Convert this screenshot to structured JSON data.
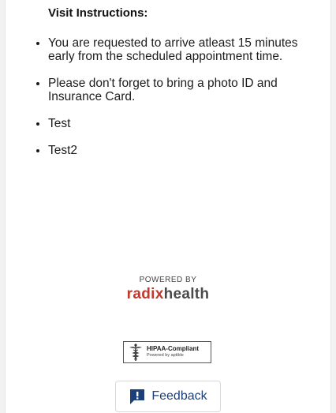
{
  "visit": {
    "title": "Visit Instructions:",
    "items": [
      "You are requested to arrive atleast 15 minutes early from the scheduled appointment time.",
      "Please don't forget to bring a photo ID and Insurance Card.",
      "Test",
      "Test2"
    ]
  },
  "footer": {
    "powered_by": "POWERED BY",
    "brand_part1": "radix",
    "brand_part2": "health",
    "hipaa_title": "HIPAA-Compliant",
    "hipaa_sub": "Powered by aptible",
    "hipaa_icon": "caduceus-icon"
  },
  "feedback": {
    "label": "Feedback",
    "icon": "feedback-icon"
  },
  "colors": {
    "brand_red": "#c0392b",
    "brand_gray": "#4a4a4a",
    "feedback_blue": "#1c3f7a"
  }
}
